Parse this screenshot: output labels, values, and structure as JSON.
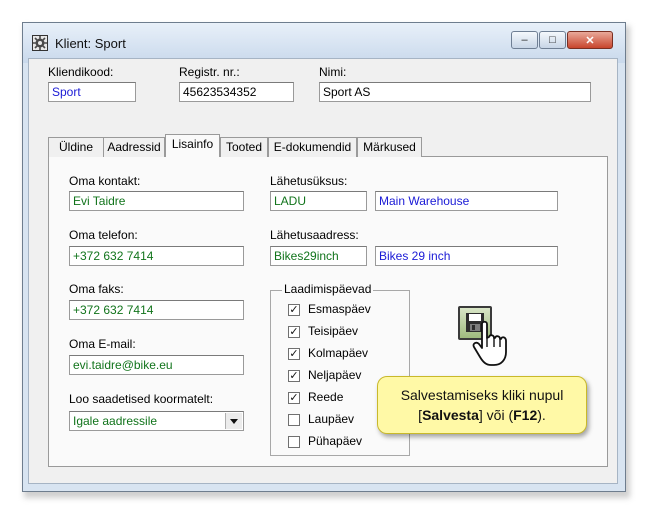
{
  "window": {
    "title": "Klient: Sport",
    "buttons": {
      "minimize": "–",
      "maximize": "□",
      "close": "✕"
    }
  },
  "header": {
    "client_code_label": "Kliendikood:",
    "client_code_value": "Sport",
    "reg_no_label": "Registr. nr.:",
    "reg_no_value": "45623534352",
    "name_label": "Nimi:",
    "name_value": "Sport AS"
  },
  "tabs": [
    {
      "label": "Üldine",
      "active": false
    },
    {
      "label": "Aadressid",
      "active": false
    },
    {
      "label": "Lisainfo",
      "active": true
    },
    {
      "label": "Tooted",
      "active": false
    },
    {
      "label": "E-dokumendid",
      "active": false
    },
    {
      "label": "Märkused",
      "active": false
    }
  ],
  "lisainfo": {
    "own_contact_label": "Oma kontakt:",
    "own_contact_value": "Evi Taidre",
    "own_phone_label": "Oma telefon:",
    "own_phone_value": "+372 632 7414",
    "own_fax_label": "Oma faks:",
    "own_fax_value": "+372 632 7414",
    "own_email_label": "Oma E-mail:",
    "own_email_value": "evi.taidre@bike.eu",
    "create_shipments_label": "Loo saadetised koormatelt:",
    "create_shipments_value": "Igale aadressile",
    "shipping_unit_label": "Lähetusüksus:",
    "shipping_unit_code": "LADU",
    "shipping_unit_name": "Main Warehouse",
    "shipping_address_label": "Lähetusaadress:",
    "shipping_address_code": "Bikes29inch",
    "shipping_address_name": "Bikes 29 inch"
  },
  "loading_days": {
    "title": "Laadimispäevad",
    "days": [
      {
        "label": "Esmaspäev",
        "checked": true,
        "mark": "✓"
      },
      {
        "label": "Teisipäev",
        "checked": true,
        "mark": "✓"
      },
      {
        "label": "Kolmapäev",
        "checked": true,
        "mark": "✓"
      },
      {
        "label": "Neljapäev",
        "checked": true,
        "mark": "✓"
      },
      {
        "label": "Reede",
        "checked": true,
        "mark": "✓"
      },
      {
        "label": "Laupäev",
        "checked": false,
        "mark": ""
      },
      {
        "label": "Pühapäev",
        "checked": false,
        "mark": ""
      }
    ]
  },
  "tooltip": {
    "line1": "Salvestamiseks kliki nupul",
    "bracket_open": "[",
    "save_word": "Salvesta",
    "middle": "] või (",
    "key": "F12",
    "end": ")."
  },
  "colors": {
    "field_blue": "#1a1ad6",
    "field_green": "#11741b",
    "tooltip_bg": "#fff9a6"
  },
  "icons": {
    "app": "gear-icon",
    "save": "floppy-disk-icon",
    "cursor": "hand-pointer-icon",
    "dropdown": "chevron-down-icon"
  }
}
